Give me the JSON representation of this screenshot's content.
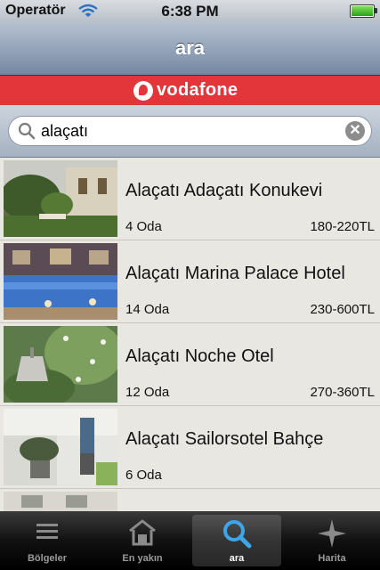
{
  "status_bar": {
    "carrier": "Operatör",
    "time": "6:38 PM"
  },
  "nav": {
    "title": "ara"
  },
  "banner": {
    "brand": "vodafone"
  },
  "search": {
    "value": "alaçatı"
  },
  "results": [
    {
      "name": "Alaçatı Adaçatı Konukevi",
      "rooms": "4 Oda",
      "price": "180-220TL"
    },
    {
      "name": "Alaçatı Marina Palace Hotel",
      "rooms": "14 Oda",
      "price": "230-600TL"
    },
    {
      "name": "Alaçatı Noche Otel",
      "rooms": "12 Oda",
      "price": "270-360TL"
    },
    {
      "name": "Alaçatı Sailorsotel Bahçe",
      "rooms": "6 Oda",
      "price": ""
    }
  ],
  "tabs": [
    {
      "label": "Bölgeler",
      "icon": "list-icon"
    },
    {
      "label": "En yakın",
      "icon": "house-icon"
    },
    {
      "label": "ara",
      "icon": "search-icon"
    },
    {
      "label": "Harita",
      "icon": "compass-star-icon"
    }
  ],
  "colors": {
    "nav": "#7486a1",
    "banner": "#e2363b",
    "active_tab_icon": "#3ea6e8"
  }
}
